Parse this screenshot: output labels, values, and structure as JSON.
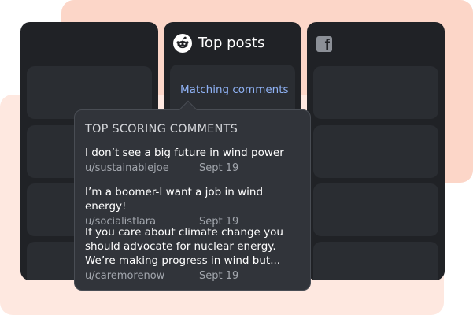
{
  "columns": {
    "middle": {
      "title": "Top posts",
      "icon": "reddit-icon",
      "matching_label": "Matching comments"
    },
    "right": {
      "icon": "facebook-icon"
    }
  },
  "popover": {
    "heading": "TOP SCORING COMMENTS",
    "comments": [
      {
        "text": "I don’t see a big future in wind power",
        "user": "u/sustainablejoe",
        "date": "Sept 19"
      },
      {
        "text": "I’m a boomer-I want a job in wind energy!",
        "user": "u/socialistlara",
        "date": "Sept 19"
      },
      {
        "text": "If you care about climate change you should advocate for nuclear energy. We’re making progress in wind but...",
        "user": "u/caremorenow",
        "date": "Sept 19"
      }
    ]
  },
  "colors": {
    "panel": "#202226",
    "card": "#2a2d32",
    "popover": "#31343a",
    "link": "#8fb2f5",
    "bg_peach": "#fcd6c8",
    "bg_light": "#fee8e0"
  }
}
